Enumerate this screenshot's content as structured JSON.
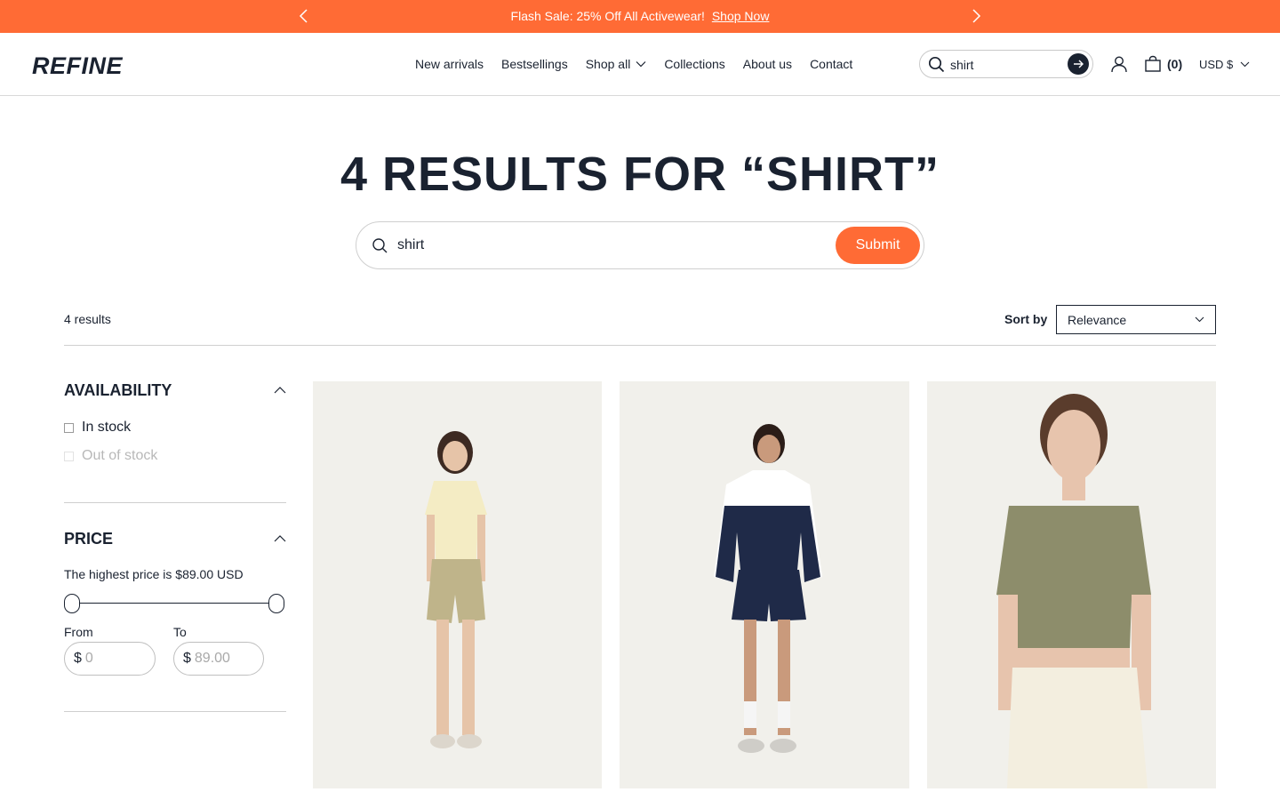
{
  "announcement": {
    "message": "Flash Sale: 25% Off All Activewear!",
    "link": "Shop Now"
  },
  "header": {
    "logo": "REFINE",
    "nav": [
      "New arrivals",
      "Bestsellings",
      "Shop all",
      "Collections",
      "About us",
      "Contact"
    ],
    "search_value": "shirt",
    "cart_count": "(0)",
    "currency": "USD $"
  },
  "main": {
    "title": "4 RESULTS FOR “SHIRT”",
    "search_value": "shirt",
    "submit_label": "Submit",
    "results_count": "4 results",
    "sort_label": "Sort by",
    "sort_value": "Relevance"
  },
  "filters": {
    "availability": {
      "heading": "AVAILABILITY",
      "options": [
        "In stock",
        "Out of stock"
      ]
    },
    "price": {
      "heading": "PRICE",
      "note": "The highest price is $89.00 USD",
      "from_label": "From",
      "to_label": "To",
      "currency_symbol": "$",
      "from_placeholder": "0",
      "to_placeholder": "89.00"
    }
  },
  "colors": {
    "accent": "#ff6b35",
    "text": "#1a2230",
    "card_bg": "#efeee9"
  }
}
